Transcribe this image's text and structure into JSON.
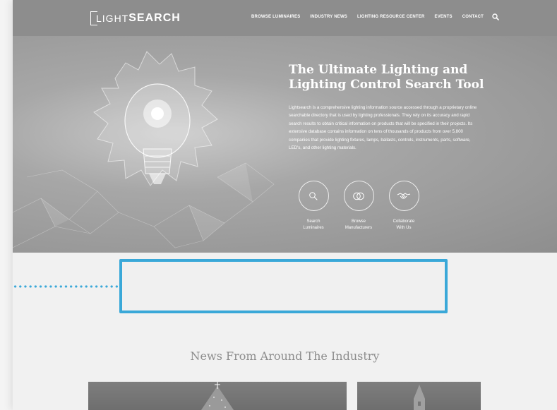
{
  "header": {
    "logo_light": "LIGHT",
    "logo_bold": "SEARCH",
    "nav": [
      "BROWSE LUMINAIRES",
      "INDUSTRY NEWS",
      "LIGHTING RESOURCE CENTER",
      "EVENTS",
      "CONTACT"
    ],
    "search_icon": "search-icon"
  },
  "hero": {
    "title_line1": "The Ultimate Lighting and",
    "title_line2": "Lighting Control Search Tool",
    "description": "Lightsearch is a comprehensive lighting information source accessed through a proprietary online searchable directory that is used by lighting professionals. They rely on its accuracy and rapid search results to obtain critical information on products that will be specified in their projects. Its extensive database contains information on tens of thousands of products from over 5,800 companies that provide lighting fixtures, lamps, ballasts, controls, instruments, parts, software, LED's, and other lighting materials.",
    "features": [
      {
        "label": "Search\nLuminaires",
        "icon": "search-icon"
      },
      {
        "label": "Browse\nManufacturers",
        "icon": "overlap-circles-icon"
      },
      {
        "label": "Collaborate\nWith Us",
        "icon": "handshake-icon"
      }
    ]
  },
  "news": {
    "title": "News From Around The Industry"
  },
  "colors": {
    "header_bg": "#8d8d8d",
    "highlight_border": "#3aa8d8",
    "page_bg": "#f1f1f1"
  }
}
